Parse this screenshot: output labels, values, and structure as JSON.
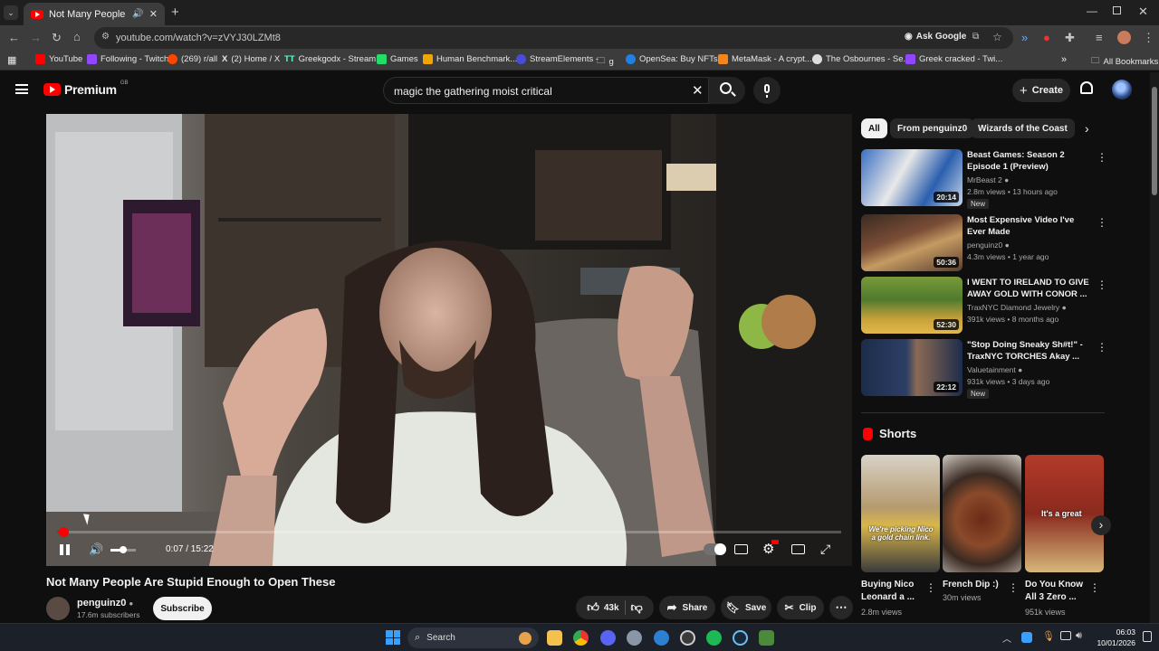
{
  "browser": {
    "tab_title": "Not Many People Are Stupi",
    "url": "youtube.com/watch?v=zVYJ30LZMt8",
    "ask_google": "Ask Google",
    "bookmarks": [
      "YouTube",
      "Following - Twitch",
      "(269) r/all",
      "(2) Home / X",
      "Greekgodx - Stream...",
      "Games",
      "Human Benchmark...",
      "StreamElements -",
      "g",
      "OpenSea: Buy NFTs,...",
      "MetaMask - A crypt...",
      "The Osbournes - Se...",
      "Greek cracked - Twi..."
    ],
    "all_bookmarks": "All Bookmarks"
  },
  "youtube": {
    "logo": "Premium",
    "logo_region": "GB",
    "search_value": "magic the gathering moist critical",
    "create_label": "Create"
  },
  "player": {
    "time": "0:07 / 15:22",
    "progress": 0.0076
  },
  "video": {
    "title": "Not Many People Are Stupid Enough to Open These",
    "channel": "penguinz0",
    "subscribers": "17.6m subscribers",
    "subscribe_label": "Subscribe",
    "likes": "43k",
    "share_label": "Share",
    "save_label": "Save",
    "clip_label": "Clip"
  },
  "sidebar": {
    "chips": [
      "All",
      "From penguinz0",
      "Wizards of the Coast"
    ],
    "recommendations": [
      {
        "title": "Beast Games: Season 2 Episode 1 (Preview)",
        "channel": "MrBeast 2",
        "meta": "2.8m views • 13 hours ago",
        "badge": "New",
        "duration": "20:14"
      },
      {
        "title": "Most Expensive Video I've Ever Made",
        "channel": "penguinz0",
        "meta": "4.3m views • 1 year ago",
        "badge": "",
        "duration": "50:36"
      },
      {
        "title": "I WENT TO IRELAND TO GIVE AWAY GOLD WITH CONOR ...",
        "channel": "TraxNYC Diamond Jewelry",
        "meta": "391k views • 8 months ago",
        "badge": "",
        "duration": "52:30"
      },
      {
        "title": "\"Stop Doing Sneaky Sh#t!\" - TraxNYC TORCHES Akay ...",
        "channel": "Valuetainment",
        "meta": "931k views • 3 days ago",
        "badge": "New",
        "duration": "22:12"
      }
    ],
    "shorts_heading": "Shorts",
    "shorts": [
      {
        "title": "Buying Nico Leonard a ...",
        "views": "2.8m views",
        "caption": "We're picking Nico a gold chain link."
      },
      {
        "title": "French Dip :)",
        "views": "30m views",
        "caption": ""
      },
      {
        "title": "Do You Know All 3 Zero ...",
        "views": "951k views",
        "caption": "It's a great"
      }
    ]
  },
  "taskbar": {
    "search_label": "Search",
    "time": "06:03",
    "date": "10/01/2026"
  },
  "colors": {
    "accent": "#ff0000",
    "background": "#0f0f0f"
  }
}
